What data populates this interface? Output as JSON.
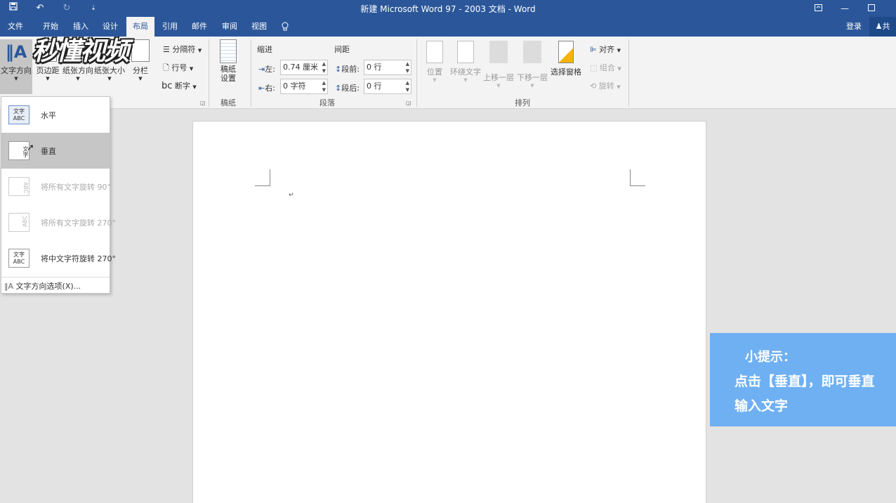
{
  "window": {
    "title": "新建 Microsoft Word 97 - 2003 文档 - Word",
    "qa_more": "⇣"
  },
  "tabs": [
    "文件",
    "开始",
    "插入",
    "设计",
    "布局",
    "引用",
    "邮件",
    "审阅",
    "视图"
  ],
  "account": {
    "signin": "登录",
    "share": "共"
  },
  "ribbon": {
    "page_setup": {
      "text_direction": "文字方向",
      "margins": "页边距",
      "orientation": "纸张方向",
      "size": "纸张大小",
      "columns": "分栏",
      "breaks": "分隔符",
      "line_numbers": "行号",
      "hyphenation": "断字"
    },
    "draft": {
      "button": "稿纸\n设置",
      "group": "稿纸"
    },
    "paragraph": {
      "indent_title": "缩进",
      "spacing_title": "间距",
      "left_label": "左:",
      "left_value": "0.74 厘米",
      "right_label": "右:",
      "right_value": "0 字符",
      "before_label": "段前:",
      "before_value": "0 行",
      "after_label": "段后:",
      "after_value": "0 行",
      "group": "段落"
    },
    "arrange": {
      "position": "位置",
      "wrap": "环绕文字",
      "forward": "上移一层",
      "backward": "下移一层",
      "selection_pane": "选择窗格",
      "align": "对齐",
      "group_cmd": "组合",
      "rotate": "旋转",
      "group": "排列"
    }
  },
  "dropdown": {
    "items": [
      {
        "label": "水平",
        "icon": "文字\nABC"
      },
      {
        "label": "垂直",
        "icon": "文字"
      },
      {
        "label": "将所有文字旋转 90°",
        "icon": "ABC"
      },
      {
        "label": "将所有文字旋转 270°",
        "icon": "ABC"
      },
      {
        "label": "将中文字符旋转 270°",
        "icon": "文字\nABC"
      }
    ],
    "options": "文字方向选项(X)..."
  },
  "document": {
    "paragraph_mark": "↵"
  },
  "tip": {
    "title": "小提示：",
    "line1": "点击【垂直】，即可垂直",
    "line2": "输入文字"
  },
  "watermark": "秒懂视频",
  "colors": {
    "accent": "#2b579a",
    "tip_bg": "#6fb0f3"
  }
}
